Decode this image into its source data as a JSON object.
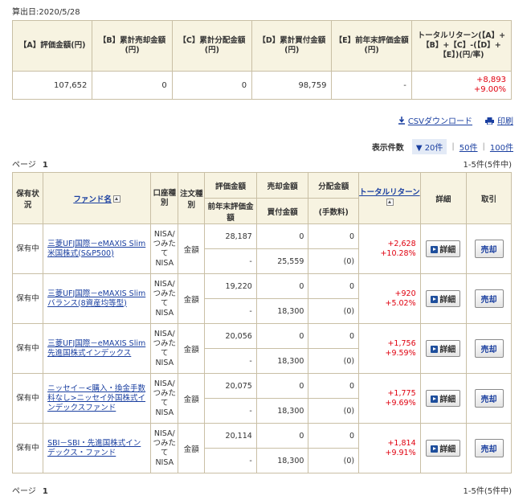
{
  "calc_date": "算出日:2020/5/28",
  "summary": {
    "headers": {
      "a": "【A】評価金額(円)",
      "b": "【B】累計売却金額(円)",
      "c": "【C】累計分配金額(円)",
      "d": "【D】累計買付金額(円)",
      "e": "【E】前年末評価金額(円)",
      "total": "トータルリターン(【A】+【B】+【C】-(【D】+【E】)(円/率)"
    },
    "values": {
      "a": "107,652",
      "b": "0",
      "c": "0",
      "d": "98,759",
      "e": "-",
      "total_yen": "+8,893",
      "total_pct": "+9.00%"
    }
  },
  "actions": {
    "csv": "CSVダウンロード",
    "print": "印刷"
  },
  "pager": {
    "label": "表示件数",
    "options": [
      "20件",
      "50件",
      "100件"
    ],
    "selected": "20件",
    "page_label": "ページ",
    "page_num": "1",
    "count_text": "1-5件(5件中)"
  },
  "table": {
    "headers": {
      "status": "保有状況",
      "fund": "ファンド名",
      "account": "口座種別",
      "order": "注文種別",
      "valuation": "評価金額",
      "prev": "前年末評価金額",
      "sell": "売却金額",
      "buy": "買付金額",
      "dist": "分配金額",
      "fee": "(手数料)",
      "ret": "トータルリターン",
      "detail": "詳細",
      "trade": "取引"
    },
    "rows": [
      {
        "status": "保有中",
        "fund": "三菱UFJ国際－eMAXIS Slim米国株式(S&P500)",
        "account": "NISA/つみたてNISA",
        "order": "金額",
        "valuation": "28,187",
        "prev": "-",
        "sell": "0",
        "buy": "25,559",
        "dist": "0",
        "fee": "(0)",
        "ret_yen": "+2,628",
        "ret_pct": "+10.28%",
        "detail": "詳細",
        "trade": "売却"
      },
      {
        "status": "保有中",
        "fund": "三菱UFJ国際－eMAXIS Slim バランス(8資産均等型)",
        "account": "NISA/つみたてNISA",
        "order": "金額",
        "valuation": "19,220",
        "prev": "-",
        "sell": "0",
        "buy": "18,300",
        "dist": "0",
        "fee": "(0)",
        "ret_yen": "+920",
        "ret_pct": "+5.02%",
        "detail": "詳細",
        "trade": "売却"
      },
      {
        "status": "保有中",
        "fund": "三菱UFJ国際－eMAXIS Slim 先進国株式インデックス",
        "account": "NISA/つみたてNISA",
        "order": "金額",
        "valuation": "20,056",
        "prev": "-",
        "sell": "0",
        "buy": "18,300",
        "dist": "0",
        "fee": "(0)",
        "ret_yen": "+1,756",
        "ret_pct": "+9.59%",
        "detail": "詳細",
        "trade": "売却"
      },
      {
        "status": "保有中",
        "fund": "ニッセイ－<購入・換金手数料なし>ニッセイ外国株式インデックスファンド",
        "account": "NISA/つみたてNISA",
        "order": "金額",
        "valuation": "20,075",
        "prev": "-",
        "sell": "0",
        "buy": "18,300",
        "dist": "0",
        "fee": "(0)",
        "ret_yen": "+1,775",
        "ret_pct": "+9.69%",
        "detail": "詳細",
        "trade": "売却"
      },
      {
        "status": "保有中",
        "fund": "SBI－SBI・先進国株式インデックス・ファンド",
        "account": "NISA/つみたてNISA",
        "order": "金額",
        "valuation": "20,114",
        "prev": "-",
        "sell": "0",
        "buy": "18,300",
        "dist": "0",
        "fee": "(0)",
        "ret_yen": "+1,814",
        "ret_pct": "+9.91%",
        "detail": "詳細",
        "trade": "売却"
      }
    ]
  },
  "colors": {
    "header_bg": "#f7f3e1",
    "border": "#c9bfa5",
    "positive": "#e0000f",
    "link": "#1a3fa0"
  }
}
